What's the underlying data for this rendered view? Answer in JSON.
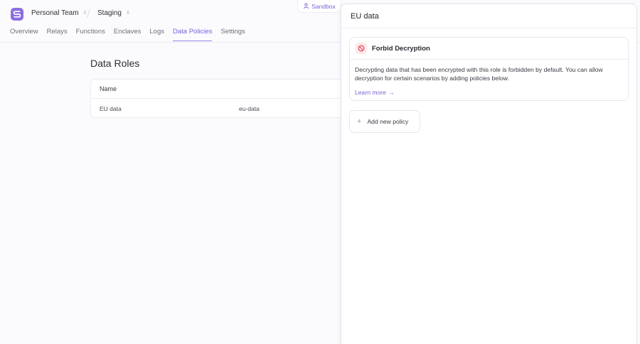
{
  "header": {
    "team": "Personal Team",
    "environment": "Staging",
    "sandbox_label": "Sandbox"
  },
  "nav": {
    "tabs": [
      {
        "label": "Overview"
      },
      {
        "label": "Relays"
      },
      {
        "label": "Functions"
      },
      {
        "label": "Enclaves"
      },
      {
        "label": "Logs"
      },
      {
        "label": "Data Policies"
      },
      {
        "label": "Settings"
      }
    ],
    "active": "Data Policies"
  },
  "main": {
    "title": "Data Roles",
    "table": {
      "column_name": "Name",
      "rows": [
        {
          "name": "EU data",
          "key": "eu-data"
        }
      ]
    }
  },
  "panel": {
    "title": "EU data",
    "card": {
      "title": "Forbid Decryption",
      "description": "Decrypting data that has been encrypted with this role is forbidden by default. You can allow decryption for certain scenarios by adding policies below.",
      "learn_more": "Learn more",
      "learn_more_arrow": "→"
    },
    "add_policy_label": "Add new policy",
    "add_policy_icon": "+"
  },
  "colors": {
    "accent": "#7c5fd6",
    "logo": "#8b6fe0",
    "forbid_bg": "#fde8ea",
    "forbid_icon": "#e0405a"
  }
}
